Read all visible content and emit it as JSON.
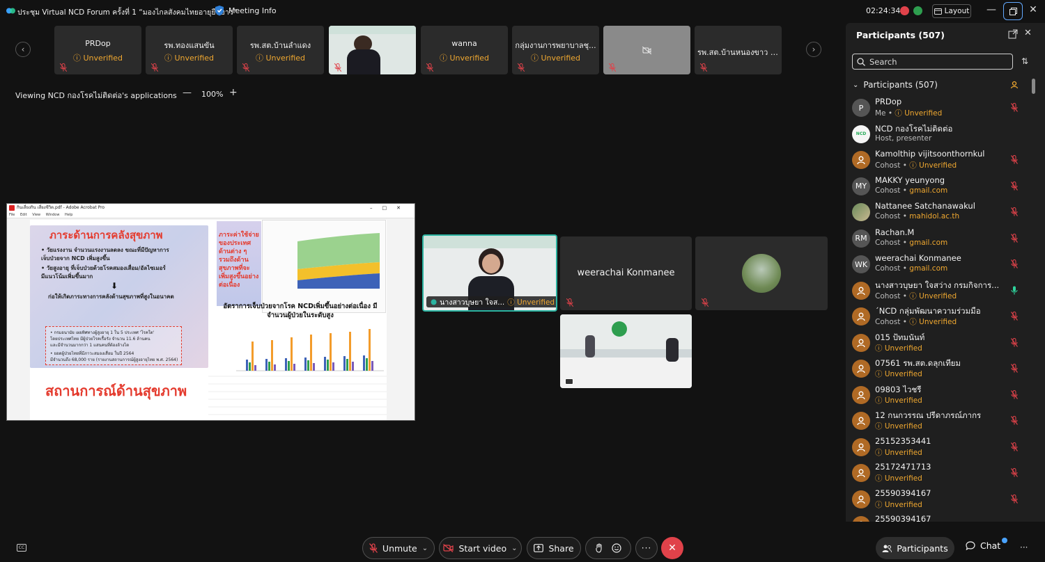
{
  "titlebar": {
    "meeting_title": "ประชุม Virtual NCD Forum ครั้งที่ 1 “มองไกลสังคมไทยอายุยืนยาว”",
    "meeting_info": "Meeting Info",
    "timer": "02:24:34",
    "layout_label": "Layout"
  },
  "strip": {
    "tiles": [
      {
        "name": "PRDop",
        "status": "Unverified"
      },
      {
        "name": "รพ.ทองแสนขัน",
        "status": "Unverified"
      },
      {
        "name": "รพ.สต.บ้านลำแดง",
        "status": "Unverified"
      },
      {
        "name": "wanna",
        "status": "Unverified"
      },
      {
        "name": "กลุ่มงานการพยาบาลชุ...",
        "status": "Unverified"
      },
      {
        "name": "รพ.สต.บ้านหนองขาว ห...",
        "status": ""
      }
    ]
  },
  "share": {
    "viewing": "Viewing NCD กองโรคไม่ติดต่อ's applications",
    "zoom": "100%",
    "window_title": "กินเสี่ยงกิน เสี่ยงชีวิต.pdf - Adobe Acrobat Pro",
    "menu": [
      "File",
      "Edit",
      "View",
      "Window",
      "Help"
    ],
    "slide_heading": "ภาระด้านการคลังสุขภาพ",
    "slide_bullets": [
      "• วัยแรงงาน  จำนวนแรงงานลดลง ขณะที่มีปัญหาการ",
      "  เจ็บป่วยจาก NCD เพิ่มสูงขึ้น",
      "• วัยสูงอายุ  ที่เจ็บป่วยด้วยโรคสมองเสื่อม/อัลไซเมอร์",
      "  มีแนวโน้มเพิ่มขึ้นมาก",
      "ก่อให้เกิดภาระทางการคลังด้านสุขภาพที่สูงในอนาคต"
    ],
    "slide_box_lines": [
      "• กรมอนามัย เผยทิศทางผู้สูงอายุ 1 ใน 5 ประเทศ 'โรคใต'",
      "  โดยประเทศไทย มีผู้ป่วยโรคเรื้อรัง จำนวน 11.6 ล้านคน",
      "  และมีจำนวนมากกว่า 1 แสนคนที่ต้องล้างไต",
      "• ยอดผู้ป่วยไทยที่มีภาวะสมองเสื่อม ในปี 2564",
      "  มีจำนวนถึง 68,000 ราย (รายงานสถานการณ์ผู้สูงอายุไทย พ.ศ. 2564)"
    ],
    "slide_footer": "สถานการณ์ด้านสุขภาพ",
    "chart1_label": "ภาระค่าใช้จ่ายของประเทศด้านต่าง ๆ รวมถึงด้านสุขภาพที่จะเพิ่มสูงขึ้นอย่างต่อเนื่อง",
    "chart2_title": "อัตราการเจ็บป่วยจากโรค NCDเพิ่มขึ้นอย่างต่อเนื่อง มีจำนวนผู้ป่วยในระดับสูง"
  },
  "videos": {
    "speaker_name": "นางสาวบุษยา ใจส...",
    "speaker_status": "Unverified",
    "name_tile": "weerachai Konmanee"
  },
  "panel": {
    "title": "Participants (507)",
    "search_placeholder": "Search",
    "group_label": "Participants (507)",
    "participants": [
      {
        "initials": "P",
        "avatar": "grey",
        "name": "PRDop",
        "role": "Me",
        "status": "Unverified",
        "status_kind": "unv",
        "mic": "muted"
      },
      {
        "initials": "NCD",
        "avatar": "logo",
        "name": "NCD กองโรคไม่ติดต่อ",
        "role": "Host, presenter",
        "status": "",
        "status_kind": "",
        "mic": "none"
      },
      {
        "initials": "",
        "avatar": "orange",
        "name": "Kamolthip vijitsoonthornkul",
        "role": "Cohost",
        "status": "Unverified",
        "status_kind": "unv",
        "mic": "muted"
      },
      {
        "initials": "MY",
        "avatar": "grey",
        "name": "MAKKY yeunyong",
        "role": "Cohost",
        "status": "gmail.com",
        "status_kind": "dom",
        "mic": "muted"
      },
      {
        "initials": "",
        "avatar": "photo",
        "name": "Nattanee Satchanawakul",
        "role": "Cohost",
        "status": "mahidol.ac.th",
        "status_kind": "dom",
        "mic": "muted"
      },
      {
        "initials": "RM",
        "avatar": "grey",
        "name": "Rachan.M",
        "role": "Cohost",
        "status": "gmail.com",
        "status_kind": "dom",
        "mic": "muted"
      },
      {
        "initials": "WK",
        "avatar": "grey",
        "name": "weerachai Konmanee",
        "role": "Cohost",
        "status": "gmail.com",
        "status_kind": "dom",
        "mic": "muted"
      },
      {
        "initials": "",
        "avatar": "orange",
        "name": "นางสาวบุษยา ใจสว่าง กรมกิจการ...",
        "role": "Cohost",
        "status": "Unverified",
        "status_kind": "unv",
        "mic": "active"
      },
      {
        "initials": "",
        "avatar": "orange",
        "name": "´NCD กลุ่มพัฒนาความร่วมมือ",
        "role": "Cohost",
        "status": "Unverified",
        "status_kind": "unv",
        "mic": "muted"
      },
      {
        "initials": "",
        "avatar": "orange",
        "name": "015 ป้ทมนันท์",
        "role": "",
        "status": "Unverified",
        "status_kind": "unv",
        "mic": "muted"
      },
      {
        "initials": "",
        "avatar": "orange",
        "name": "07561 รพ.สต.ดลุกเทียม",
        "role": "",
        "status": "Unverified",
        "status_kind": "unv",
        "mic": "muted"
      },
      {
        "initials": "",
        "avatar": "orange",
        "name": "09803 ไวชรี",
        "role": "",
        "status": "Unverified",
        "status_kind": "unv",
        "mic": "muted"
      },
      {
        "initials": "",
        "avatar": "orange",
        "name": "12 กนกวรรณ ปรีดาภรณ์ภากร",
        "role": "",
        "status": "Unverified",
        "status_kind": "unv",
        "mic": "muted"
      },
      {
        "initials": "",
        "avatar": "orange",
        "name": "25152353441",
        "role": "",
        "status": "Unverified",
        "status_kind": "unv",
        "mic": "muted"
      },
      {
        "initials": "",
        "avatar": "orange",
        "name": "25172471713",
        "role": "",
        "status": "Unverified",
        "status_kind": "unv",
        "mic": "muted"
      },
      {
        "initials": "",
        "avatar": "orange",
        "name": "25590394167",
        "role": "",
        "status": "Unverified",
        "status_kind": "unv",
        "mic": "muted"
      },
      {
        "initials": "",
        "avatar": "orange",
        "name": "25590394167",
        "role": "",
        "status": "",
        "status_kind": "",
        "mic": "none"
      }
    ]
  },
  "toolbar": {
    "unmute": "Unmute",
    "start_video": "Start video",
    "share": "Share",
    "participants": "Participants",
    "chat": "Chat"
  },
  "colors": {
    "accent": "#62a9ff",
    "unverified": "#f0a830",
    "end": "#e0424a",
    "speaker_border": "#2bb3a0"
  }
}
